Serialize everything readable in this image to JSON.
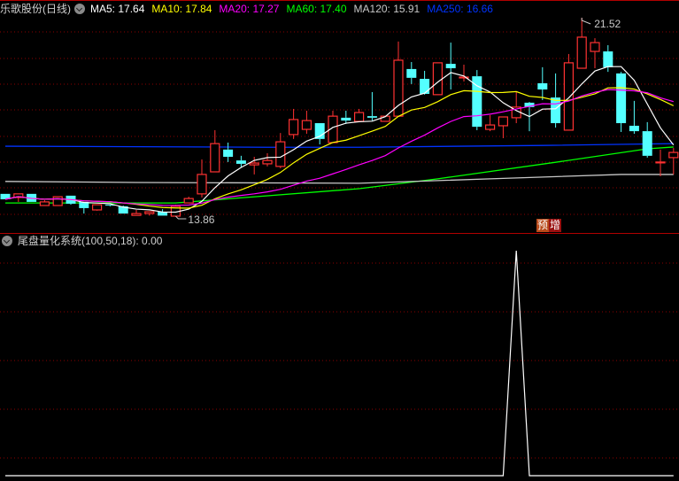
{
  "header": {
    "title": "乐歌股份(日线)",
    "ma": [
      {
        "label": "MA5: 17.64",
        "color": "#ffffff"
      },
      {
        "label": "MA10: 17.84",
        "color": "#ffff00"
      },
      {
        "label": "MA20: 17.27",
        "color": "#ff00ff"
      },
      {
        "label": "MA60: 17.40",
        "color": "#00ff00"
      },
      {
        "label": "MA120: 15.91",
        "color": "#c8c8c8"
      },
      {
        "label": "MA250: 16.66",
        "color": "#0033ff"
      }
    ]
  },
  "annotations": {
    "high_label": "21.52",
    "low_label": "13.86"
  },
  "badge": {
    "part1": "预",
    "part2": "增",
    "color1": "#b84a1a",
    "color2": "#9a1010"
  },
  "indicator": {
    "title": "尾盘量化系统(100,50,18)",
    "value": " : 0.00"
  },
  "colors": {
    "up": "#ff3232",
    "down": "#54ffff",
    "grid": "#8b0000"
  },
  "chart_data": [
    {
      "type": "candlestick",
      "ylim": [
        13.5,
        22.3
      ],
      "candles": [
        [
          14.72,
          14.51,
          14.72,
          14.51
        ],
        [
          14.58,
          14.72,
          14.72,
          14.41
        ],
        [
          14.72,
          14.41,
          14.72,
          14.41
        ],
        [
          14.27,
          14.41,
          14.48,
          14.27
        ],
        [
          14.27,
          14.61,
          14.61,
          14.27
        ],
        [
          14.65,
          14.34,
          14.65,
          14.3
        ],
        [
          14.41,
          14.17,
          14.41,
          13.96
        ],
        [
          14.1,
          14.3,
          14.3,
          14.07
        ],
        [
          14.3,
          14.27,
          14.3,
          14.24
        ],
        [
          14.24,
          13.96,
          14.27,
          13.96
        ],
        [
          13.89,
          13.96,
          14.1,
          13.89
        ],
        [
          13.96,
          14.03,
          14.03,
          13.88
        ],
        [
          14.03,
          13.88,
          14.13,
          13.88
        ],
        [
          13.86,
          14.24,
          14.3,
          13.86
        ],
        [
          14.37,
          14.54,
          14.61,
          14.37
        ],
        [
          14.72,
          15.47,
          16.05,
          14.58
        ],
        [
          15.57,
          16.66,
          17.18,
          15.57
        ],
        [
          16.43,
          16.15,
          16.7,
          15.95
        ],
        [
          16.01,
          15.88,
          16.19,
          15.74
        ],
        [
          15.84,
          15.91,
          16.15,
          15.47
        ],
        [
          15.88,
          16.01,
          16.29,
          15.78
        ],
        [
          15.78,
          16.73,
          17.07,
          15.71
        ],
        [
          17.01,
          17.59,
          18.0,
          16.84
        ],
        [
          17.21,
          17.55,
          17.93,
          17.04
        ],
        [
          17.45,
          16.84,
          17.45,
          16.63
        ],
        [
          16.7,
          17.72,
          17.93,
          16.7
        ],
        [
          17.66,
          17.55,
          17.93,
          17.42
        ],
        [
          17.52,
          17.86,
          18.0,
          17.52
        ],
        [
          17.72,
          17.66,
          18.65,
          17.55
        ],
        [
          17.52,
          17.72,
          17.72,
          17.52
        ],
        [
          17.72,
          19.88,
          20.6,
          17.72
        ],
        [
          19.54,
          19.2,
          19.81,
          18.96
        ],
        [
          19.16,
          18.58,
          19.47,
          18.55
        ],
        [
          18.55,
          19.78,
          19.78,
          18.55
        ],
        [
          19.74,
          19.57,
          20.56,
          18.75
        ],
        [
          19.2,
          19.23,
          19.71,
          19.06
        ],
        [
          19.26,
          17.31,
          19.5,
          17.18
        ],
        [
          17.21,
          17.38,
          17.76,
          17.14
        ],
        [
          17.35,
          17.69,
          17.69,
          16.87
        ],
        [
          17.66,
          18.07,
          18.68,
          17.45
        ],
        [
          18.24,
          18.07,
          18.27,
          17.14
        ],
        [
          18.99,
          18.75,
          19.61,
          18.34
        ],
        [
          18.44,
          17.45,
          19.37,
          17.28
        ],
        [
          17.18,
          19.78,
          20.12,
          17.18
        ],
        [
          19.57,
          20.77,
          21.52,
          19.57
        ],
        [
          20.22,
          20.56,
          20.73,
          19.57
        ],
        [
          20.22,
          19.61,
          20.46,
          19.43
        ],
        [
          19.37,
          17.45,
          19.43,
          17.11
        ],
        [
          17.35,
          17.14,
          18.31,
          17.04
        ],
        [
          17.14,
          16.19,
          17.49,
          16.12
        ],
        [
          15.95,
          15.95,
          16.43,
          15.4
        ],
        [
          16.12,
          16.32,
          16.49,
          15.47
        ]
      ],
      "candle_fields": [
        "open",
        "close",
        "high",
        "low"
      ],
      "long_ma": [
        {
          "name": "MA60",
          "color": "#00ff00",
          "points": [
            [
              0,
              14.37
            ],
            [
              13,
              14.37
            ],
            [
              27,
              14.92
            ],
            [
              33,
              15.3
            ],
            [
              42,
              15.94
            ],
            [
              49,
              16.46
            ],
            [
              51,
              16.53
            ]
          ]
        },
        {
          "name": "MA120",
          "color": "#c8c8c8",
          "points": [
            [
              0,
              15.2
            ],
            [
              10,
              15.16
            ],
            [
              27,
              15.13
            ],
            [
              37,
              15.3
            ],
            [
              47,
              15.47
            ],
            [
              51,
              15.47
            ]
          ]
        },
        {
          "name": "MA250",
          "color": "#0033ff",
          "points": [
            [
              0,
              16.56
            ],
            [
              20,
              16.52
            ],
            [
              27,
              16.52
            ],
            [
              41,
              16.59
            ],
            [
              51,
              16.66
            ]
          ]
        }
      ],
      "short_ma": [
        {
          "name": "MA5",
          "period": 5,
          "color": "#ffffff"
        },
        {
          "name": "MA10",
          "period": 10,
          "color": "#ffff00"
        },
        {
          "name": "MA20",
          "period": 20,
          "color": "#ff00ff"
        }
      ],
      "high_index": 44,
      "low_index": 13
    },
    {
      "type": "line",
      "name": "尾盘量化系统",
      "ylim": [
        0,
        1
      ],
      "values": [
        0,
        0,
        0,
        0,
        0,
        0,
        0,
        0,
        0,
        0,
        0,
        0,
        0,
        0,
        0,
        0,
        0,
        0,
        0,
        0,
        0,
        0,
        0,
        0,
        0,
        0,
        0,
        0,
        0,
        0,
        0,
        0,
        0,
        0,
        0,
        0,
        0,
        0,
        0,
        1,
        0,
        0,
        0,
        0,
        0,
        0,
        0,
        0,
        0,
        0,
        0,
        0
      ]
    }
  ]
}
